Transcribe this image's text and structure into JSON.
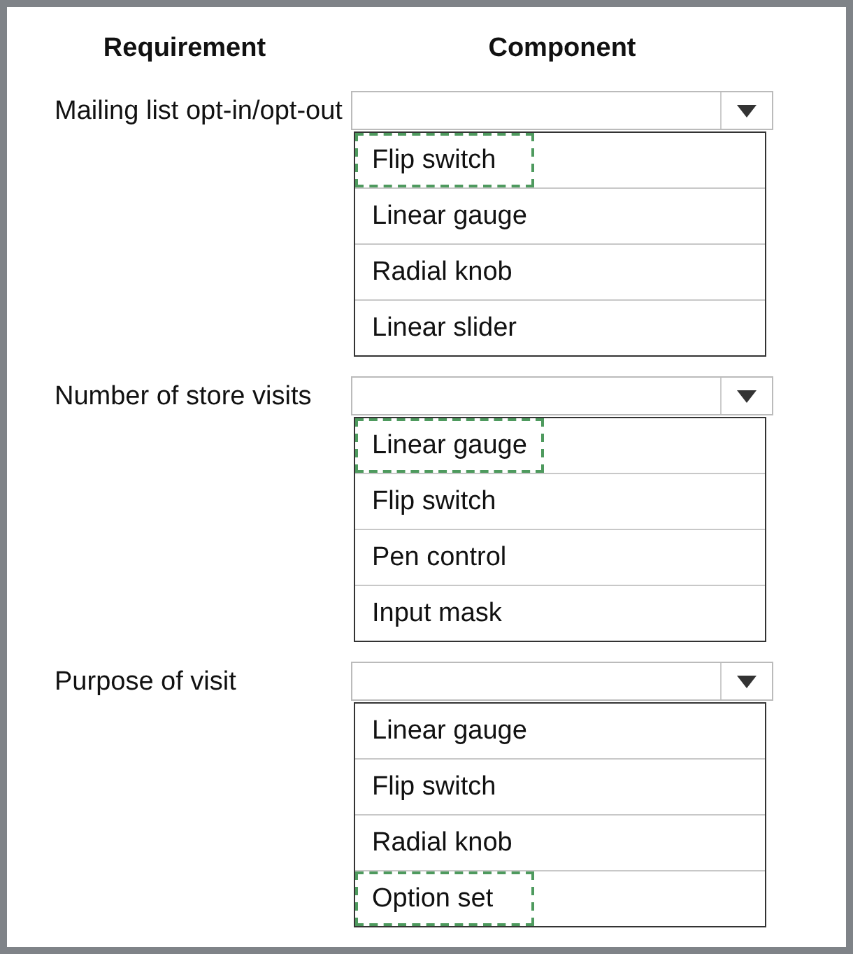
{
  "headers": {
    "requirement": "Requirement",
    "component": "Component"
  },
  "rows": [
    {
      "requirement": "Mailing list opt-in/opt-out",
      "options": [
        {
          "label": "Flip switch",
          "selected": true
        },
        {
          "label": "Linear gauge",
          "selected": false
        },
        {
          "label": "Radial knob",
          "selected": false
        },
        {
          "label": "Linear slider",
          "selected": false
        }
      ]
    },
    {
      "requirement": "Number of store visits",
      "options": [
        {
          "label": "Linear gauge",
          "selected": true
        },
        {
          "label": "Flip switch",
          "selected": false
        },
        {
          "label": "Pen control",
          "selected": false
        },
        {
          "label": "Input mask",
          "selected": false
        }
      ]
    },
    {
      "requirement": "Purpose of visit",
      "options": [
        {
          "label": "Linear gauge",
          "selected": false
        },
        {
          "label": "Flip switch",
          "selected": false
        },
        {
          "label": "Radial knob",
          "selected": false
        },
        {
          "label": "Option set",
          "selected": true
        }
      ]
    }
  ]
}
